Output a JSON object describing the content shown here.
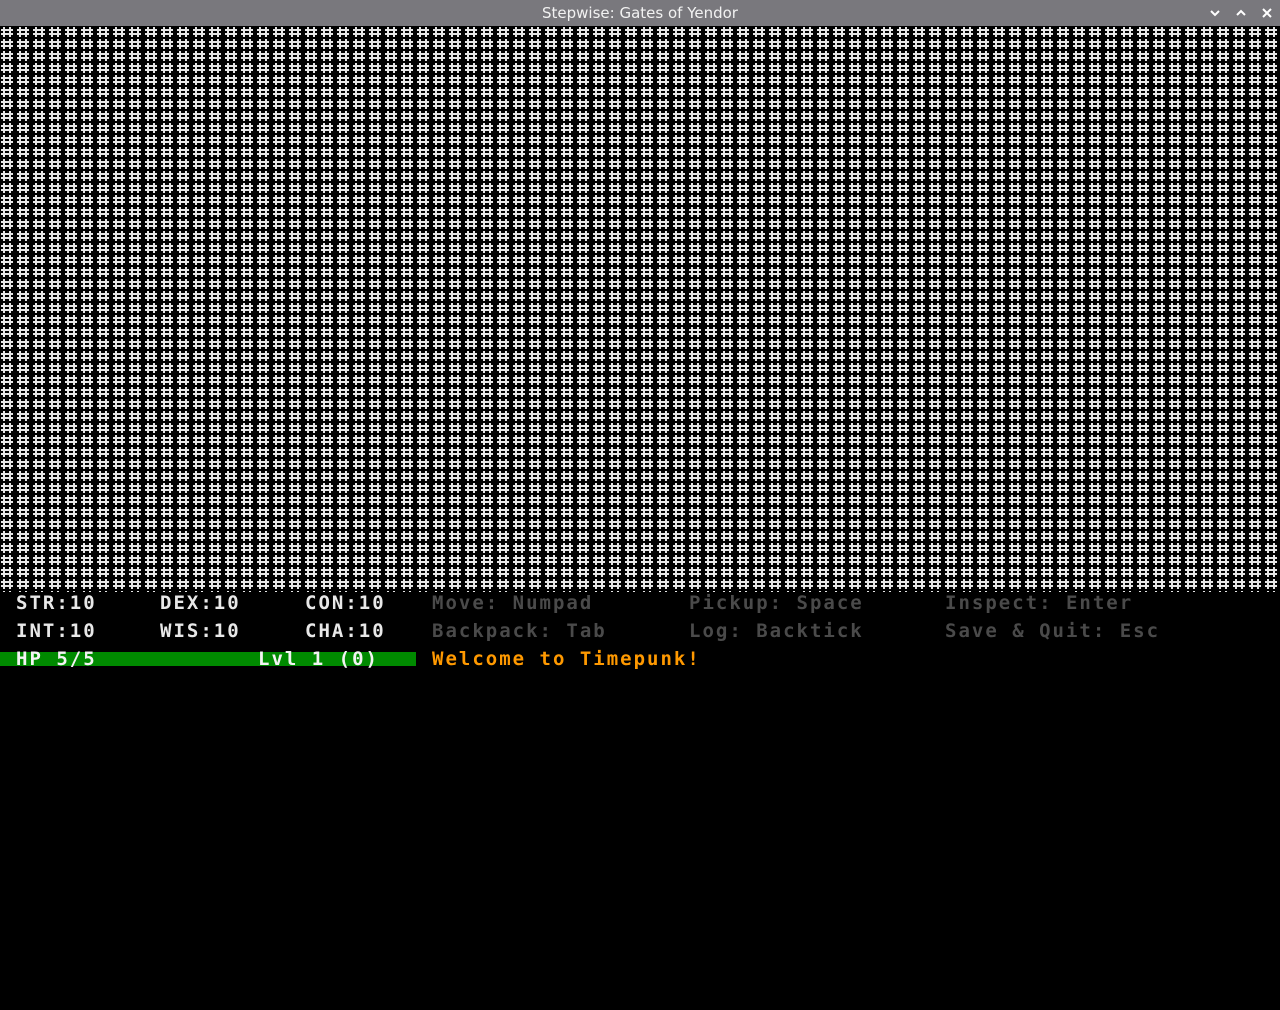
{
  "window": {
    "title": "Stepwise: Gates of Yendor",
    "buttons": {
      "minimize_icon": "chevron-down-icon",
      "maximize_icon": "chevron-up-icon",
      "close_icon": "close-icon"
    }
  },
  "map": {
    "tile_glyph": "#",
    "tile_color": "#e6e6e6"
  },
  "stats": {
    "str": "STR:10",
    "dex": "DEX:10",
    "con": "CON:10",
    "int": "INT:10",
    "wis": "WIS:10",
    "cha": "CHA:10"
  },
  "hints": {
    "move": "Move: Numpad",
    "pickup": "Pickup: Space",
    "inspect": "Inspect: Enter",
    "backpack": "Backpack: Tab",
    "log": "Log: Backtick",
    "save_quit": "Save & Quit: Esc"
  },
  "hp": {
    "label": "HP 5/5",
    "current": 5,
    "max": 5,
    "level": "Lvl 1 (0)",
    "bar_color": "#008a00"
  },
  "message_log": {
    "latest": "Welcome to Timepunk!",
    "color": "#ff9900"
  }
}
